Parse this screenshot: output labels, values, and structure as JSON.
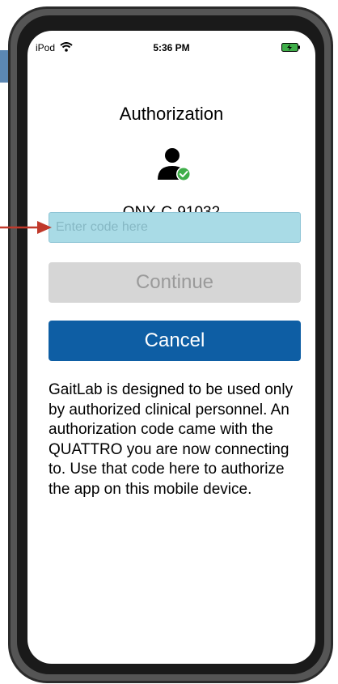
{
  "status_bar": {
    "device": "iPod",
    "time": "5:36 PM"
  },
  "icons": {
    "wifi": "wifi-icon",
    "battery": "battery-charging-icon",
    "user": "user-check-icon",
    "arrow": "pointer-arrow-icon"
  },
  "screen": {
    "title": "Authorization",
    "device_id": "QNX-C-91032",
    "code_input": {
      "placeholder": "Enter code here",
      "value": ""
    },
    "continue_label": "Continue",
    "cancel_label": "Cancel",
    "info_text": "GaitLab is designed to be used only by authorized clinical personnel. An authorization code came with the QUATTRO you are now connecting to. Use that code here to authorize the app on this mobile device."
  },
  "colors": {
    "input_bg": "#a9dbe6",
    "continue_bg": "#d6d6d6",
    "cancel_bg": "#0e5ea4",
    "arrow": "#c0392b",
    "check_green": "#3fae49"
  }
}
